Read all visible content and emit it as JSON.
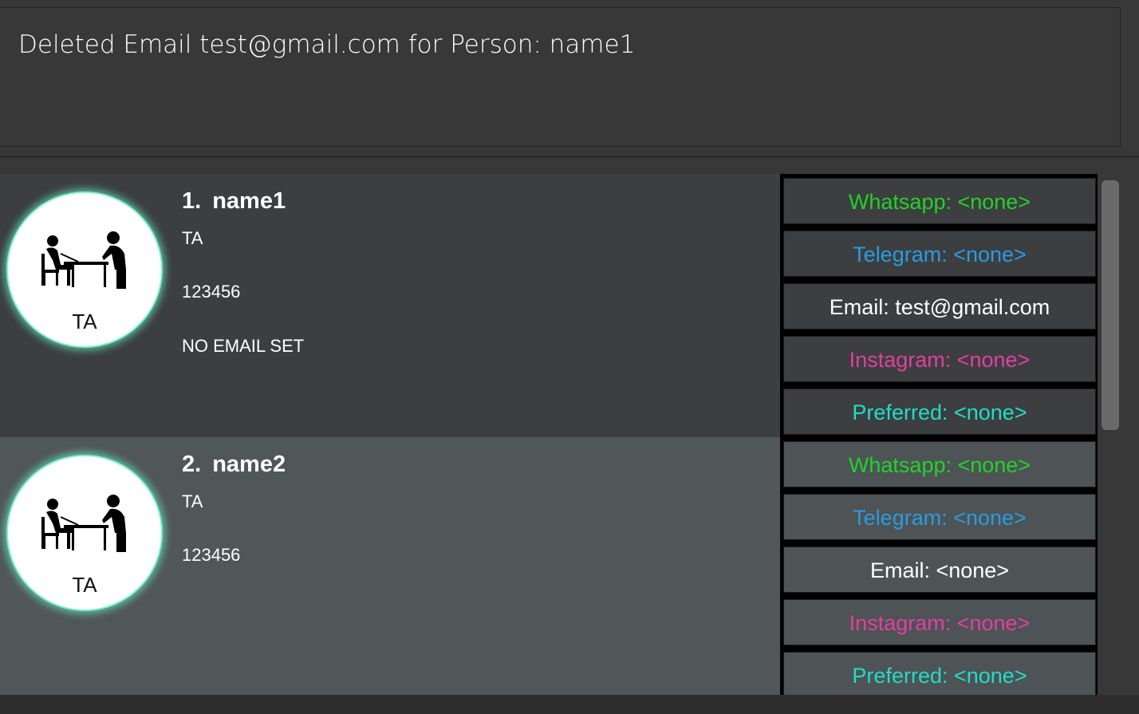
{
  "result": {
    "message": "Deleted Email test@gmail.com for Person: name1"
  },
  "persons": [
    {
      "index": "1.",
      "name": "name1",
      "role": "TA",
      "phone": "123456",
      "email_status": "NO EMAIL SET",
      "avatar_label": "TA",
      "contacts": {
        "whatsapp": "Whatsapp: <none>",
        "telegram": "Telegram: <none>",
        "email": "Email: test@gmail.com",
        "instagram": "Instagram: <none>",
        "preferred": "Preferred: <none>"
      }
    },
    {
      "index": "2.",
      "name": "name2",
      "role": "TA",
      "phone": "123456",
      "avatar_label": "TA",
      "contacts": {
        "whatsapp": "Whatsapp: <none>",
        "telegram": "Telegram: <none>",
        "email": "Email: <none>",
        "instagram": "Instagram: <none>",
        "preferred": "Preferred: <none>"
      }
    }
  ],
  "colors": {
    "whatsapp": "#22d22a",
    "telegram": "#2b9bdf",
    "email": "#ffffff",
    "instagram": "#e040a0",
    "preferred": "#22dcc8",
    "avatar_glow": "#7ef0c9"
  },
  "icons": {
    "avatar": "ta-teaching-icon"
  }
}
